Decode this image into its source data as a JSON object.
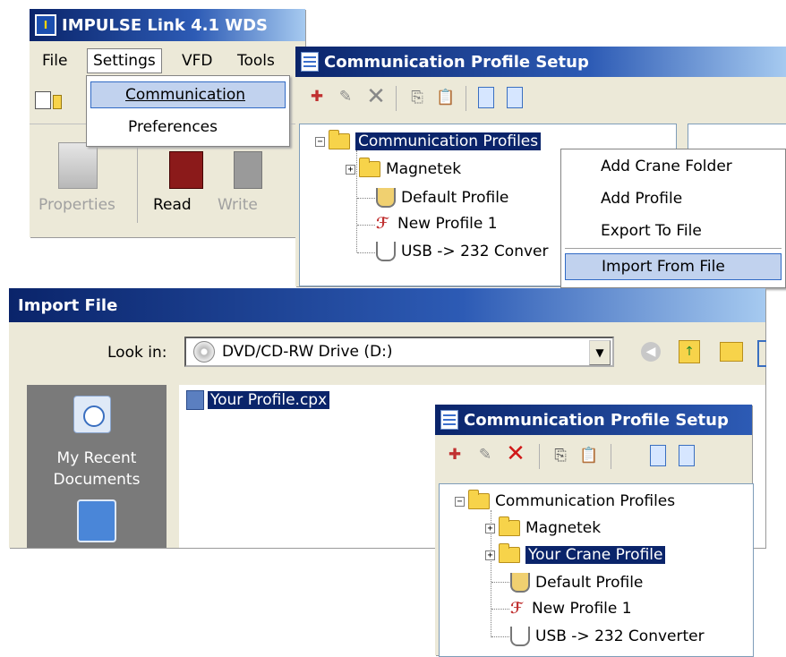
{
  "main_window": {
    "title": "IMPULSE Link 4.1 WDS",
    "menu": [
      "File",
      "Settings",
      "VFD",
      "Tools"
    ],
    "toolbar": {
      "properties": "Properties",
      "read": "Read",
      "write": "Write"
    }
  },
  "settings_menu": {
    "items": [
      "Communication",
      "Preferences"
    ],
    "highlighted": "Communication"
  },
  "comm_setup_top": {
    "title": "Communication Profile Setup",
    "tree": {
      "root": "Communication Profiles",
      "items": [
        "Magnetek",
        "Default Profile",
        "New Profile 1",
        "USB -> 232 Conver"
      ]
    }
  },
  "context_menu": {
    "items": [
      "Add Crane Folder",
      "Add Profile",
      "Export To File",
      "Import From File"
    ],
    "highlighted": "Import From File"
  },
  "import_dialog": {
    "title": "Import File",
    "look_in_label": "Look in:",
    "look_in_value": "DVD/CD-RW Drive (D:)",
    "places": [
      "My Recent Documents"
    ],
    "file": "Your Profile.cpx"
  },
  "comm_setup_bottom": {
    "title": "Communication Profile Setup",
    "tree": {
      "root": "Communication Profiles",
      "items": [
        "Magnetek",
        "Your Crane Profile",
        "Default Profile",
        "New Profile 1",
        "USB -> 232 Converter"
      ]
    }
  },
  "colors": {
    "title_dark": "#0a246a",
    "title_light": "#a6caf0",
    "menu_highlight": "#c1d2ee",
    "selection": "#0a246a",
    "panel": "#ece9d8"
  }
}
